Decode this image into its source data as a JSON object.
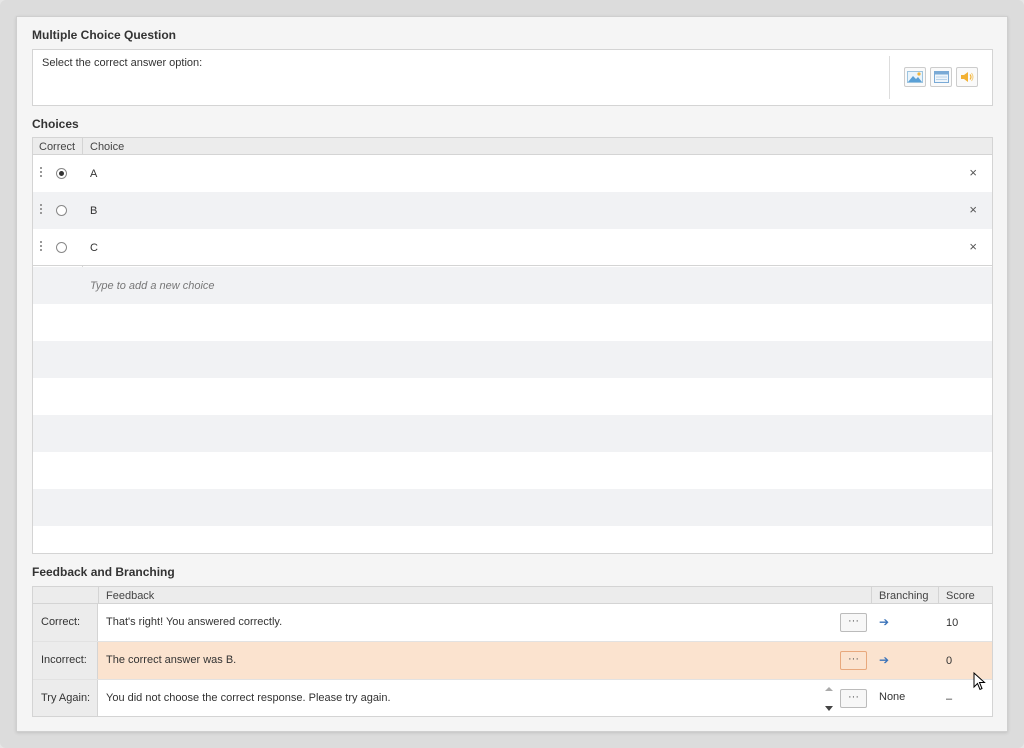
{
  "question": {
    "section_title": "Multiple Choice Question",
    "prompt": "Select the correct answer option:",
    "media_buttons": [
      {
        "icon": "image-icon"
      },
      {
        "icon": "window-icon"
      },
      {
        "icon": "audio-icon"
      }
    ]
  },
  "choices": {
    "section_title": "Choices",
    "col_correct": "Correct",
    "col_choice": "Choice",
    "items": [
      {
        "label": "A",
        "correct": true
      },
      {
        "label": "B",
        "correct": false
      },
      {
        "label": "C",
        "correct": false
      }
    ],
    "add_placeholder": "Type to add a new choice",
    "remove_glyph": "×"
  },
  "feedback": {
    "section_title": "Feedback and Branching",
    "col_feedback": "Feedback",
    "col_branching": "Branching",
    "col_score": "Score",
    "more_label": "···",
    "rows": [
      {
        "label": "Correct:",
        "text": "That's right! You answered correctly.",
        "branching": "➔",
        "score": "10"
      },
      {
        "label": "Incorrect:",
        "text": "The correct answer was B.",
        "branching": "➔",
        "score": "0"
      },
      {
        "label": "Try Again:",
        "text": "You did not choose the correct response. Please try again.",
        "branching": "None",
        "score": "–"
      }
    ]
  },
  "colors": {
    "highlight_row": "#fbe3cf",
    "branch_arrow": "#3b73b9",
    "alt_row": "#f1f2f4"
  }
}
